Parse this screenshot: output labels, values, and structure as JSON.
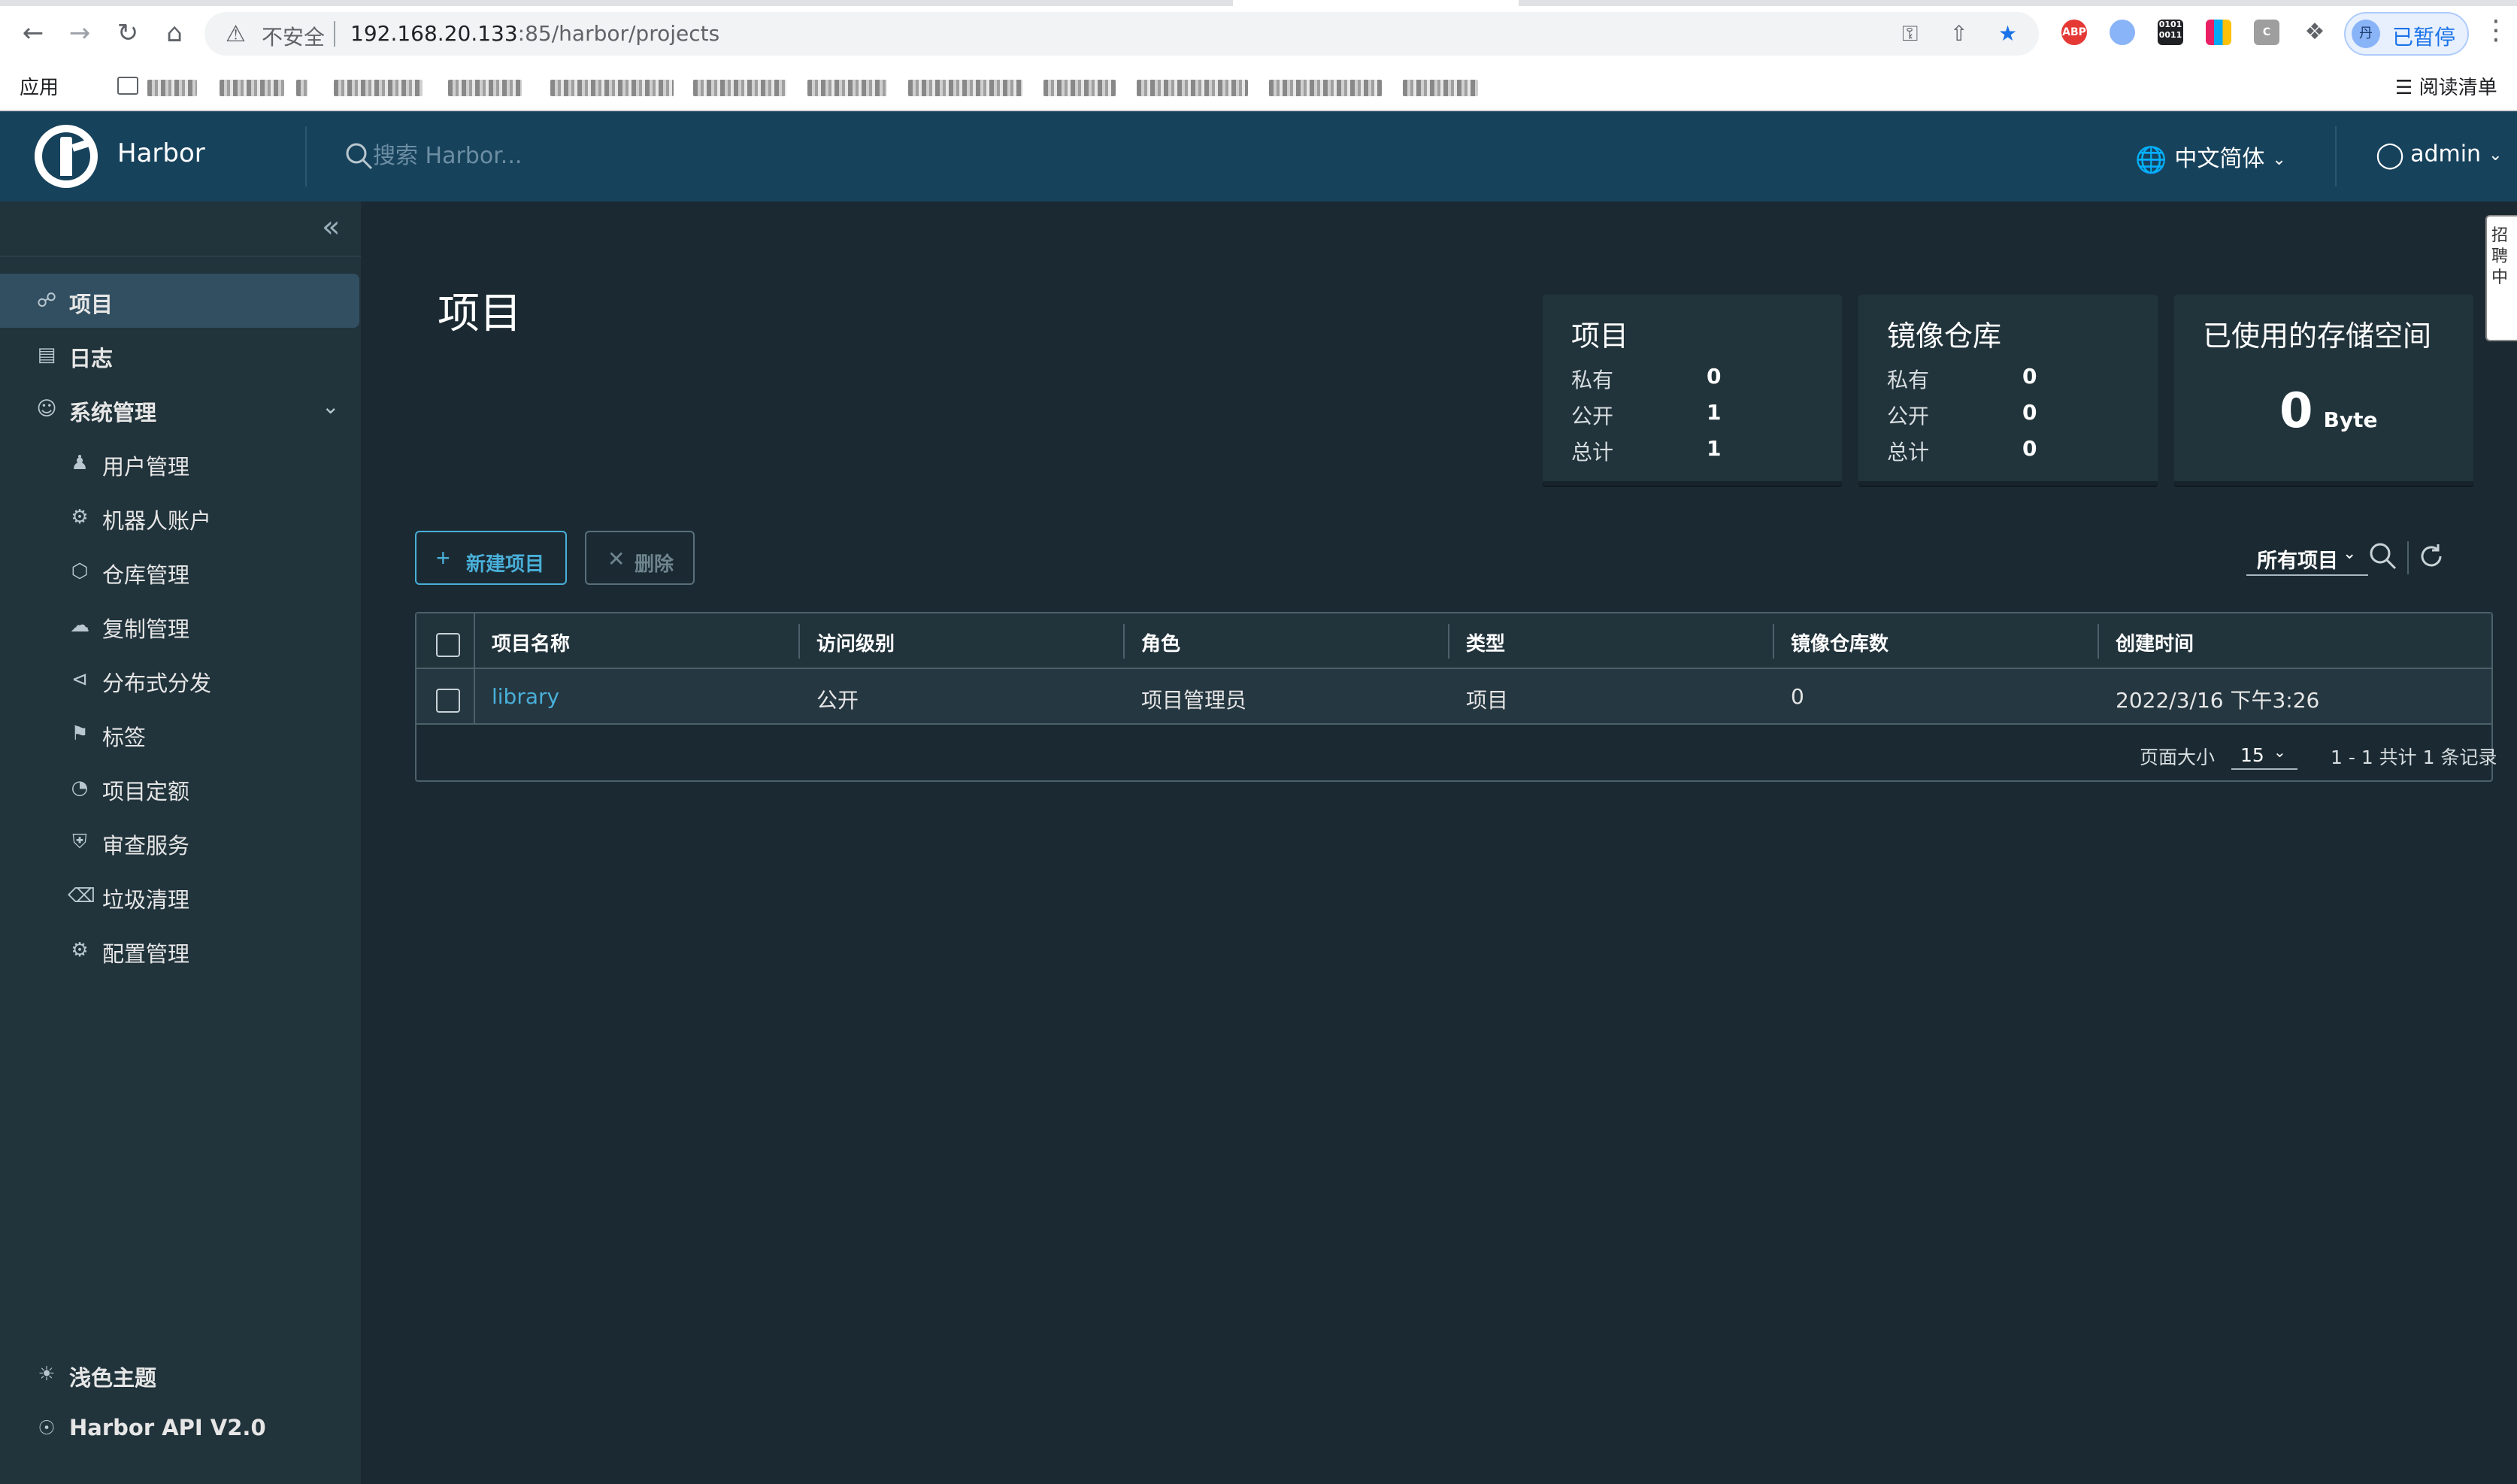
{
  "browser": {
    "insecure_label": "不安全",
    "url_host": "192.168.20.133",
    "url_path": ":85/harbor/projects",
    "bookmarks_apps_label": "应用",
    "reading_list_label": "阅读清单",
    "profile_avatar": "丹",
    "profile_status": "已暂停"
  },
  "header": {
    "brand": "Harbor",
    "search_placeholder": "搜索 Harbor...",
    "language": "中文简体",
    "user": "admin"
  },
  "sidebar": {
    "items": [
      {
        "label": "项目",
        "icon": "projects-icon"
      },
      {
        "label": "日志",
        "icon": "logs-icon"
      },
      {
        "label": "系统管理",
        "icon": "admin-icon"
      }
    ],
    "sub_items": [
      {
        "label": "用户管理",
        "icon": "users-icon"
      },
      {
        "label": "机器人账户",
        "icon": "robot-icon"
      },
      {
        "label": "仓库管理",
        "icon": "registry-icon"
      },
      {
        "label": "复制管理",
        "icon": "replication-icon"
      },
      {
        "label": "分布式分发",
        "icon": "distribution-icon"
      },
      {
        "label": "标签",
        "icon": "tag-icon"
      },
      {
        "label": "项目定额",
        "icon": "quota-icon"
      },
      {
        "label": "审查服务",
        "icon": "shield-icon"
      },
      {
        "label": "垃圾清理",
        "icon": "trash-icon"
      },
      {
        "label": "配置管理",
        "icon": "gear-icon"
      }
    ],
    "bottom": {
      "theme": "浅色主题",
      "api": "Harbor API V2.0"
    }
  },
  "main": {
    "title": "项目",
    "cards": {
      "projects": {
        "title": "项目",
        "private_label": "私有",
        "private": "0",
        "public_label": "公开",
        "public": "1",
        "total_label": "总计",
        "total": "1"
      },
      "repos": {
        "title": "镜像仓库",
        "private_label": "私有",
        "private": "0",
        "public_label": "公开",
        "public": "0",
        "total_label": "总计",
        "total": "0"
      },
      "storage": {
        "title": "已使用的存储空间",
        "value": "0",
        "unit": "Byte"
      }
    },
    "new_button": "新建项目",
    "delete_button": "删除",
    "filter_selected": "所有项目",
    "table": {
      "columns": [
        "项目名称",
        "访问级别",
        "角色",
        "类型",
        "镜像仓库数",
        "创建时间"
      ],
      "rows": [
        [
          "library",
          "公开",
          "项目管理员",
          "项目",
          "0",
          "2022/3/16 下午3:26"
        ]
      ],
      "page_size_label": "页面大小",
      "page_size": "15",
      "summary": "1 - 1 共计 1 条记录"
    }
  },
  "right_tab_label": "招聘中"
}
